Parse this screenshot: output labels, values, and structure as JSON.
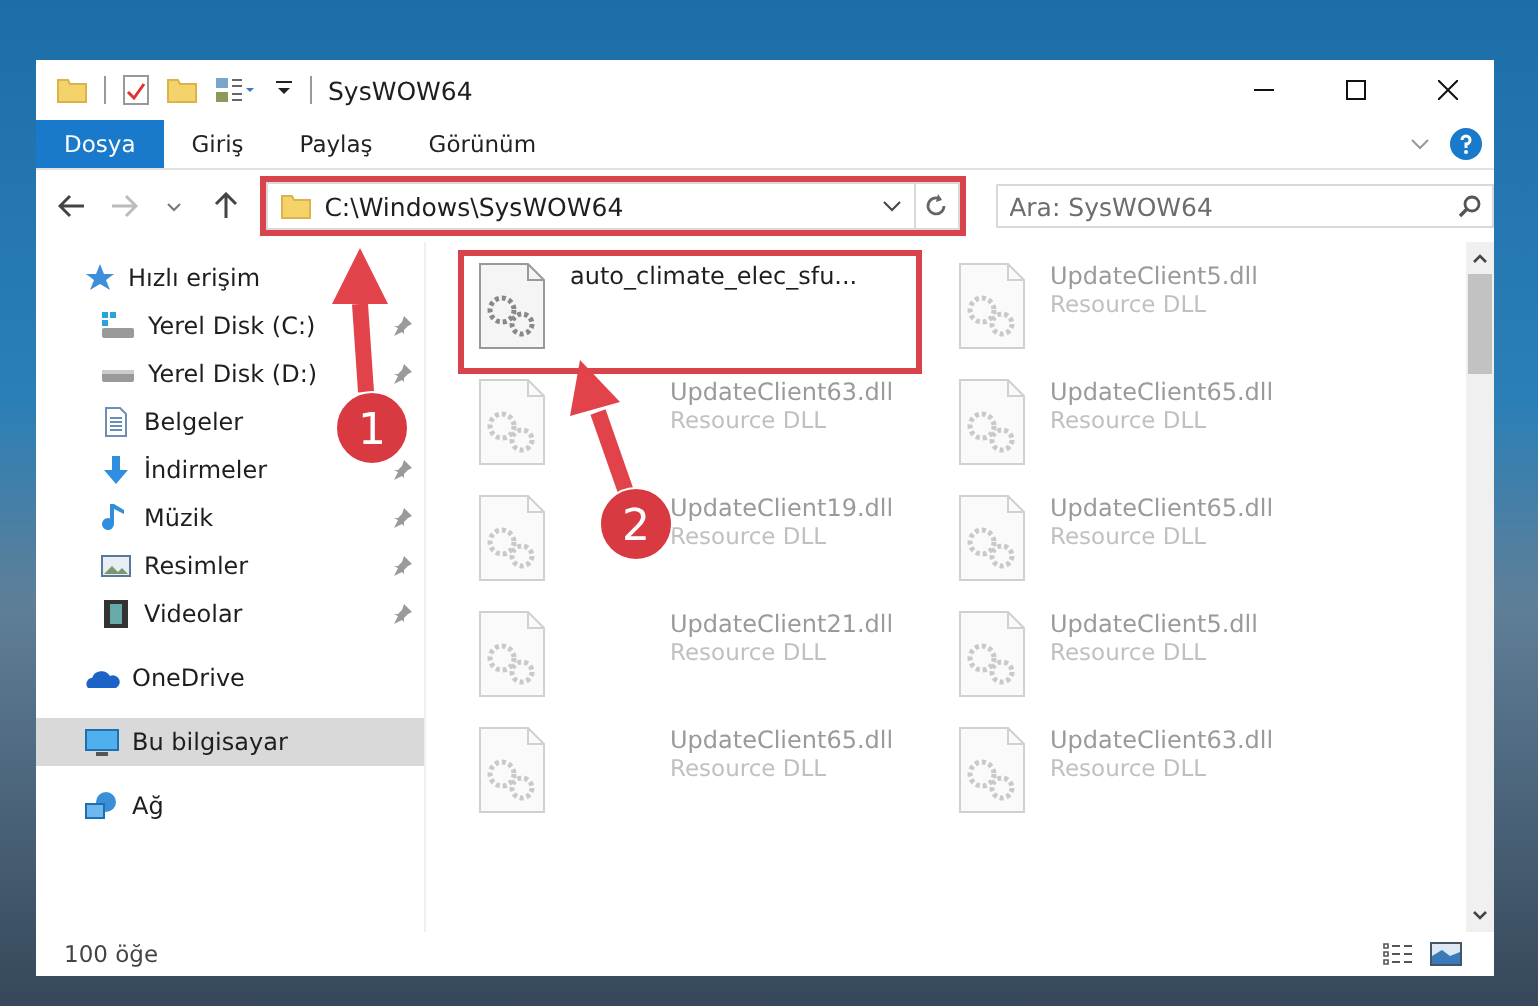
{
  "window": {
    "title": "SysWOW64"
  },
  "ribbon_tabs": [
    {
      "label": "Dosya",
      "selected": true
    },
    {
      "label": "Giriş",
      "selected": false
    },
    {
      "label": "Paylaş",
      "selected": false
    },
    {
      "label": "Görünüm",
      "selected": false
    }
  ],
  "address_bar": {
    "path": "C:\\Windows\\SysWOW64",
    "highlighted": true
  },
  "search": {
    "placeholder": "Ara: SysWOW64"
  },
  "sidebar": {
    "items": [
      {
        "label": "Hızlı erişim",
        "selected": false,
        "children": [
          {
            "label": "Yerel Disk (C:)",
            "pinned": true
          },
          {
            "label": "Yerel Disk (D:)",
            "pinned": true
          },
          {
            "label": "Belgeler",
            "pinned": false
          },
          {
            "label": "İndirmeler",
            "pinned": true
          },
          {
            "label": "Müzik",
            "pinned": true
          },
          {
            "label": "Resimler",
            "pinned": true
          },
          {
            "label": "Videolar",
            "pinned": true
          }
        ]
      },
      {
        "label": "OneDrive",
        "selected": false
      },
      {
        "label": "Bu bilgisayar",
        "selected": true
      },
      {
        "label": "Ağ",
        "selected": false
      }
    ]
  },
  "files": [
    {
      "name": "auto_climate_elec_sfu...",
      "highlighted": true,
      "dimmed": false
    },
    {
      "name": "UpdateClient5.dll",
      "type": "Resource DLL",
      "highlighted": false,
      "dimmed": true
    },
    {
      "name": "UpdateClient63.dll",
      "type": "Resource DLL",
      "highlighted": false,
      "dimmed": true
    },
    {
      "name": "UpdateClient65.dll",
      "type": "Resource DLL",
      "highlighted": false,
      "dimmed": true
    },
    {
      "name": "UpdateClient19.dll",
      "type": "Resource DLL",
      "highlighted": false,
      "dimmed": true
    },
    {
      "name": "UpdateClient65.dll",
      "type": "Resource DLL",
      "highlighted": false,
      "dimmed": true
    },
    {
      "name": "UpdateClient21.dll",
      "type": "Resource DLL",
      "highlighted": false,
      "dimmed": true
    },
    {
      "name": "UpdateClient5.dll",
      "type": "Resource DLL",
      "highlighted": false,
      "dimmed": true
    },
    {
      "name": "UpdateClient65.dll",
      "type": "Resource DLL",
      "highlighted": false,
      "dimmed": true
    },
    {
      "name": "UpdateClient63.dll",
      "type": "Resource DLL",
      "highlighted": false,
      "dimmed": true
    }
  ],
  "status_bar": {
    "count": "100 öğe"
  },
  "annotations": [
    {
      "label": "1"
    },
    {
      "label": "2"
    }
  ]
}
